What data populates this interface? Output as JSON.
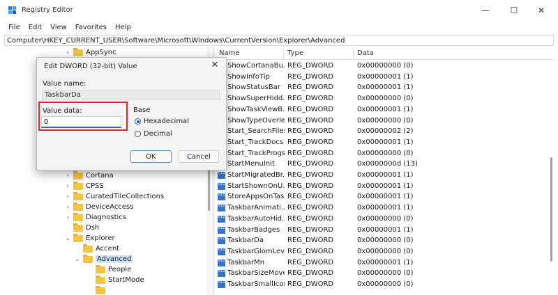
{
  "window": {
    "title": "Registry Editor",
    "controls": {
      "minimize": "—",
      "maximize": "☐",
      "close": "✕"
    }
  },
  "menu": [
    "File",
    "Edit",
    "View",
    "Favorites",
    "Help"
  ],
  "address": "Computer\\HKEY_CURRENT_USER\\Software\\Microsoft\\Windows\\CurrentVersion\\Explorer\\Advanced",
  "tree": [
    {
      "label": "AppSync",
      "expanded": false,
      "depth": 1
    },
    {
      "label": "Cortana",
      "expanded": false,
      "depth": 1
    },
    {
      "label": "CPSS",
      "expanded": false,
      "depth": 1
    },
    {
      "label": "CuratedTileCollections",
      "expanded": false,
      "depth": 1
    },
    {
      "label": "DeviceAccess",
      "expanded": false,
      "depth": 1
    },
    {
      "label": "Diagnostics",
      "expanded": false,
      "depth": 1
    },
    {
      "label": "Dsh",
      "expanded": null,
      "depth": 1
    },
    {
      "label": "Explorer",
      "expanded": true,
      "depth": 1
    },
    {
      "label": "Accent",
      "expanded": null,
      "depth": 2
    },
    {
      "label": "Advanced",
      "expanded": true,
      "depth": 2,
      "selected": true
    },
    {
      "label": "People",
      "expanded": null,
      "depth": 3
    },
    {
      "label": "StartMode",
      "expanded": null,
      "depth": 3
    }
  ],
  "values_header": {
    "name": "Name",
    "type": "Type",
    "data": "Data"
  },
  "values": [
    {
      "name": "ShowCortanaBu...",
      "type": "REG_DWORD",
      "data": "0x00000000 (0)"
    },
    {
      "name": "ShowInfoTip",
      "type": "REG_DWORD",
      "data": "0x00000001 (1)"
    },
    {
      "name": "ShowStatusBar",
      "type": "REG_DWORD",
      "data": "0x00000001 (1)"
    },
    {
      "name": "ShowSuperHidd...",
      "type": "REG_DWORD",
      "data": "0x00000000 (0)"
    },
    {
      "name": "ShowTaskViewB...",
      "type": "REG_DWORD",
      "data": "0x00000001 (1)"
    },
    {
      "name": "ShowTypeOverley",
      "type": "REG_DWORD",
      "data": "0x00000000 (0)"
    },
    {
      "name": "Start_SearchFiles",
      "type": "REG_DWORD",
      "data": "0x00000002 (2)"
    },
    {
      "name": "Start_TrackDocs",
      "type": "REG_DWORD",
      "data": "0x00000001 (1)"
    },
    {
      "name": "Start_TrackProgs",
      "type": "REG_DWORD",
      "data": "0x00000000 (0)"
    },
    {
      "name": "StartMenuInit",
      "type": "REG_DWORD",
      "data": "0x0000000d (13)"
    },
    {
      "name": "StartMigratedBr...",
      "type": "REG_DWORD",
      "data": "0x00000001 (1)"
    },
    {
      "name": "StartShownOnU...",
      "type": "REG_DWORD",
      "data": "0x00000001 (1)"
    },
    {
      "name": "StoreAppsOnTas...",
      "type": "REG_DWORD",
      "data": "0x00000001 (1)"
    },
    {
      "name": "TaskbarAnimati...",
      "type": "REG_DWORD",
      "data": "0x00000001 (1)"
    },
    {
      "name": "TaskbarAutoHid...",
      "type": "REG_DWORD",
      "data": "0x00000000 (0)"
    },
    {
      "name": "TaskbarBadges",
      "type": "REG_DWORD",
      "data": "0x00000001 (1)"
    },
    {
      "name": "TaskbarDa",
      "type": "REG_DWORD",
      "data": "0x00000000 (0)"
    },
    {
      "name": "TaskbarGlomLevel",
      "type": "REG_DWORD",
      "data": "0x00000000 (0)"
    },
    {
      "name": "TaskbarMn",
      "type": "REG_DWORD",
      "data": "0x00000001 (1)"
    },
    {
      "name": "TaskbarSizeMove",
      "type": "REG_DWORD",
      "data": "0x00000000 (0)"
    },
    {
      "name": "TaskbarSmallIcons",
      "type": "REG_DWORD",
      "data": "0x00000000 (0)"
    }
  ],
  "value_icon_text": "011\n110",
  "dialog": {
    "title": "Edit DWORD (32-bit) Value",
    "value_name_label": "Value name:",
    "value_name": "TaskbarDa",
    "value_data_label": "Value data:",
    "value_data": "0",
    "base_label": "Base",
    "base_options": [
      {
        "label": "Hexadecimal",
        "selected": true
      },
      {
        "label": "Decimal",
        "selected": false
      }
    ],
    "ok_label": "OK",
    "cancel_label": "Cancel",
    "close_glyph": "✕"
  },
  "colors": {
    "accent": "#1f6fc4",
    "highlight_box": "#e0262e",
    "folder": "#f0c54a",
    "reg_icon": "#3a73c4"
  }
}
